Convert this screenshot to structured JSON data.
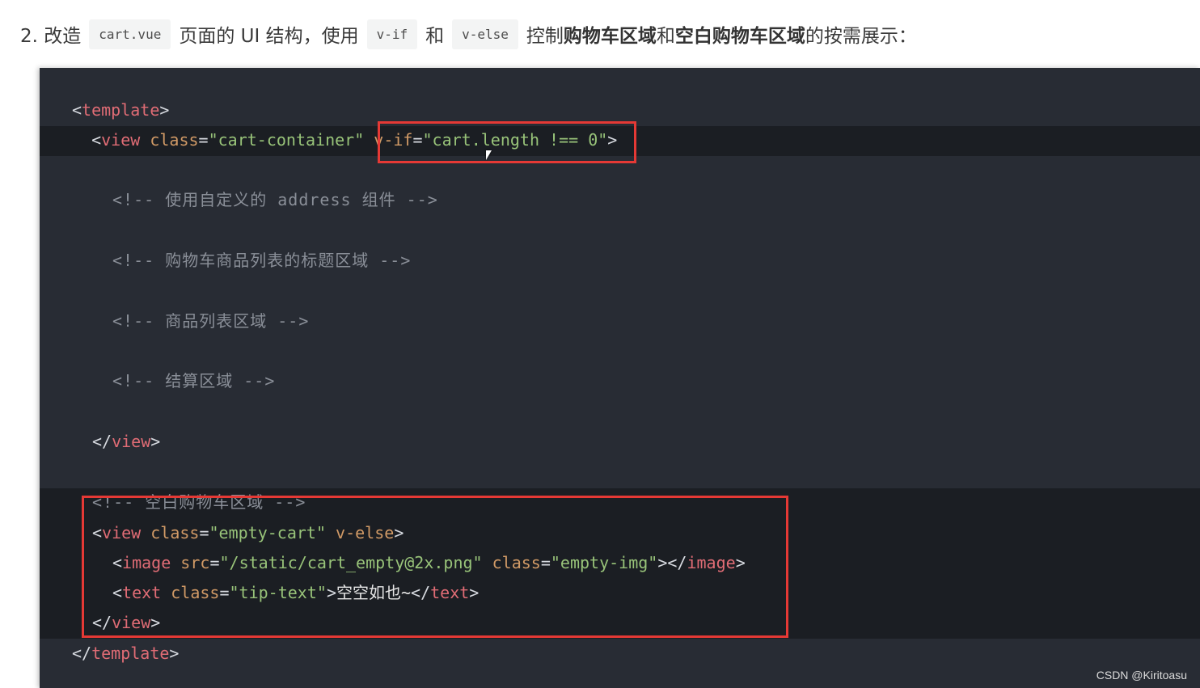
{
  "intro": {
    "number": "2. 改造",
    "file_code": "cart.vue",
    "text1": "页面的 UI 结构，使用",
    "vif_code": "v-if",
    "and": "和",
    "velse_code": "v-else",
    "text2": "控制",
    "bold1": "购物车区域",
    "text3": "和",
    "bold2": "空白购物车区域",
    "text4": "的按需展示："
  },
  "code": {
    "l1_open": "<",
    "l1_tag": "template",
    "l1_close": ">",
    "l2_indent": "  <",
    "l2_tag": "view",
    "l2_attr": " class",
    "l2_eq": "=",
    "l2_val": "\"cart-container\"",
    "l2_attr2": " v-if",
    "l2_eq2": "=",
    "l2_val2": "\"cart.length !== 0\"",
    "l2_close": ">",
    "c1": "<!-- 使用自定义的 address 组件 -->",
    "c2": "<!-- 购物车商品列表的标题区域 -->",
    "c3": "<!-- 商品列表区域 -->",
    "c4": "<!-- 结算区域 -->",
    "l7_open": "</",
    "l7_tag": "view",
    "l7_close": ">",
    "c5": "<!-- 空白购物车区域 -->",
    "l9_open": "<",
    "l9_tag": "view",
    "l9_attr": " class",
    "l9_eq": "=",
    "l9_val": "\"empty-cart\"",
    "l9_attr2": " v-else",
    "l9_close": ">",
    "l10_open": "<",
    "l10_tag": "image",
    "l10_attr": " src",
    "l10_eq": "=",
    "l10_val": "\"/static/cart_empty@2x.png\"",
    "l10_attr2": " class",
    "l10_eq2": "=",
    "l10_val2": "\"empty-img\"",
    "l10_mid": "></",
    "l10_tag2": "image",
    "l10_close": ">",
    "l11_open": "<",
    "l11_tag": "text",
    "l11_attr": " class",
    "l11_eq": "=",
    "l11_val": "\"tip-text\"",
    "l11_gt": ">",
    "l11_text": "空空如也~",
    "l11_end": "</",
    "l11_tag2": "text",
    "l11_close": ">",
    "l12_open": "</",
    "l12_tag": "view",
    "l12_close": ">",
    "l13_open": "</",
    "l13_tag": "template",
    "l13_close": ">"
  },
  "watermark": "CSDN @Kiritoasu",
  "colors": {
    "code_bg": "#282c34",
    "highlight_bg": "#1b1e23",
    "tag": "#e06c75",
    "attr": "#d19a66",
    "string": "#98c379",
    "comment": "#8a8f98",
    "annotation_box": "#e53935"
  }
}
